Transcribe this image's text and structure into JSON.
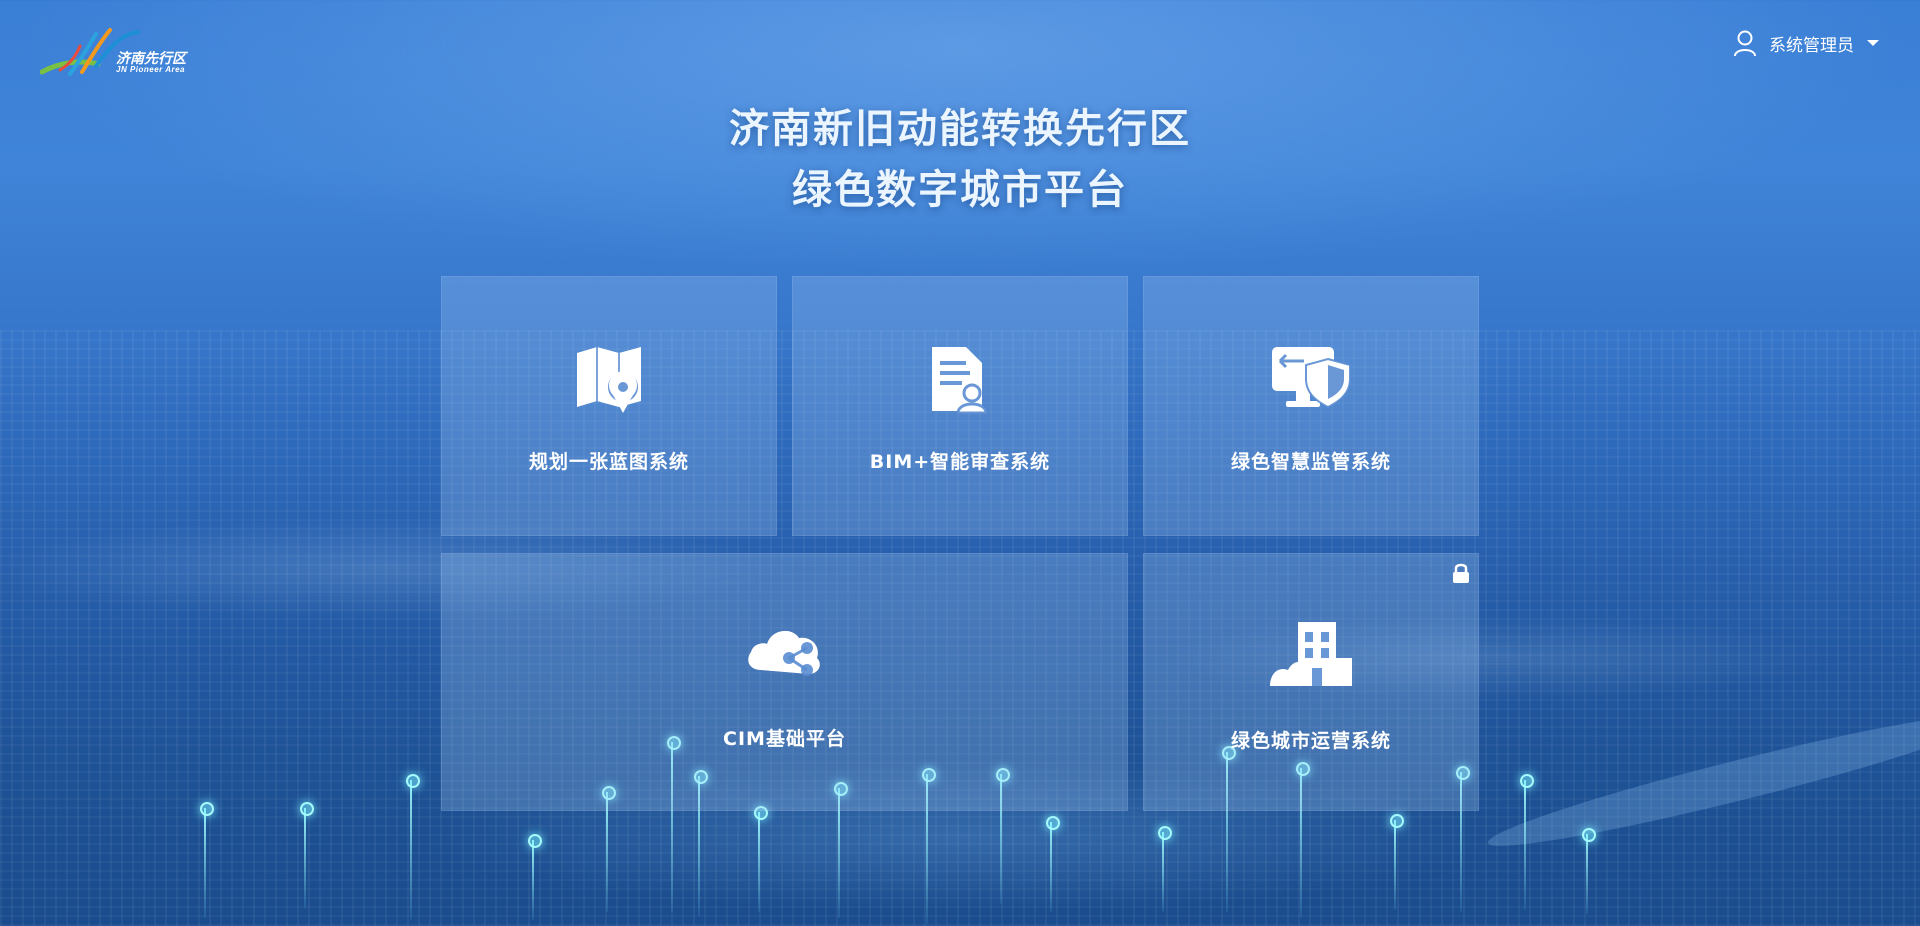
{
  "header": {
    "logo_cn": "济南先行区",
    "logo_en": "JN Pioneer Area",
    "user_name": "系统管理员"
  },
  "title": {
    "line1": "济南新旧动能转换先行区",
    "line2": "绿色数字城市平台"
  },
  "cards": [
    {
      "label": "规划一张蓝图系统",
      "icon": "map-pin-icon"
    },
    {
      "label": "BIM+智能审查系统",
      "icon": "document-user-icon"
    },
    {
      "label": "绿色智慧监管系统",
      "icon": "monitor-shield-icon"
    },
    {
      "label": "CIM基础平台",
      "icon": "cloud-share-icon"
    },
    {
      "label": "绿色城市运营系统",
      "icon": "building-icon",
      "locked": true
    }
  ],
  "colors": {
    "background": "#3a7fd6",
    "title_text": "#eaf5ff",
    "card_bg": "rgba(170,205,245,0.26)",
    "accent_cyan": "#7ef4ff"
  }
}
